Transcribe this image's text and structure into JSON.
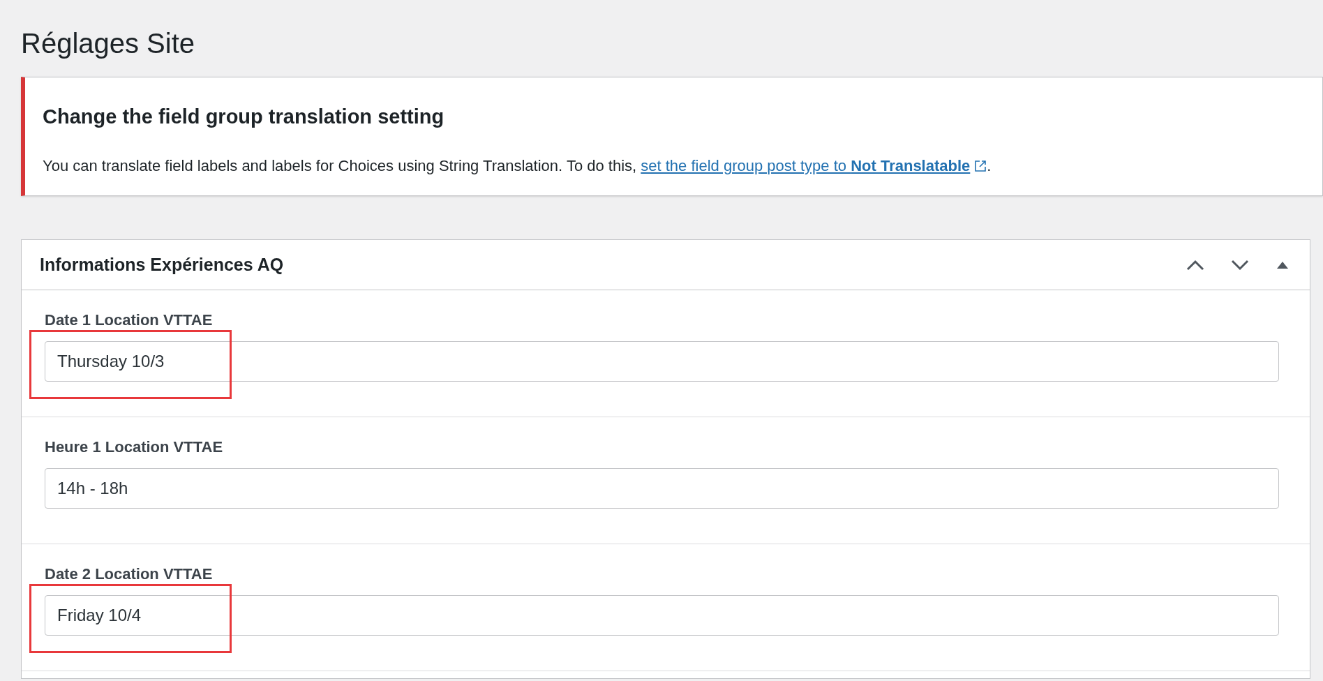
{
  "page_title": "Réglages Site",
  "notice": {
    "title": "Change the field group translation setting",
    "text": "You can translate field labels and labels for Choices using String Translation. To do this, ",
    "link": "set the field group post type to **Not Translatable**",
    "after_link": "."
  },
  "panel": {
    "title": "Informations Expériences AQ",
    "expanded": true,
    "fields": [
      {
        "label": "Date 1 Location VTTAE",
        "value": "Thursday 10/3",
        "highlighted": true
      },
      {
        "label": "Heure 1 Location VTTAE",
        "value": "14h - 18h",
        "highlighted": false
      },
      {
        "label": "Date 2 Location VTTAE",
        "value": "Friday 10/4",
        "highlighted": true
      }
    ]
  }
}
